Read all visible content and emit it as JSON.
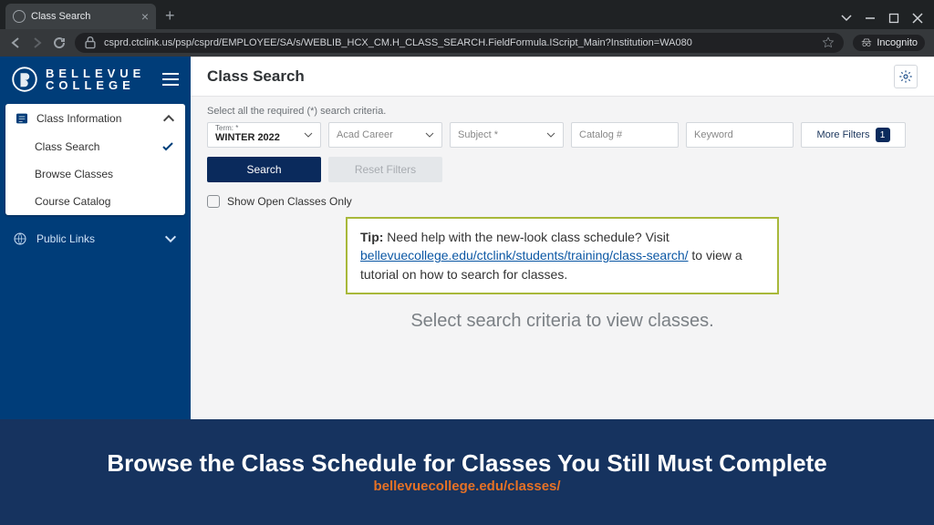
{
  "browser": {
    "tab_title": "Class Search",
    "url": "csprd.ctclink.us/psp/csprd/EMPLOYEE/SA/s/WEBLIB_HCX_CM.H_CLASS_SEARCH.FieldFormula.IScript_Main?Institution=WA080",
    "incognito_label": "Incognito"
  },
  "brand": {
    "line1": "BELLEVUE",
    "line2": "COLLEGE"
  },
  "sidebar": {
    "section_label": "Class Information",
    "items": [
      "Class Search",
      "Browse Classes",
      "Course Catalog"
    ],
    "public_label": "Public Links"
  },
  "page": {
    "title": "Class Search"
  },
  "criteria": {
    "helper": "Select all the required (*) search criteria.",
    "term_label": "Term: *",
    "term_value": "WINTER 2022",
    "acad_placeholder": "Acad Career",
    "subject_placeholder": "Subject *",
    "catalog_placeholder": "Catalog #",
    "keyword_placeholder": "Keyword",
    "more_label": "More Filters",
    "more_count": "1",
    "search_btn": "Search",
    "reset_btn": "Reset Filters",
    "open_only": "Show Open Classes Only"
  },
  "tip": {
    "prefix": "Tip:",
    "before": " Need help with the new-look class schedule? Visit ",
    "link": "bellevuecollege.edu/ctclink/students/training/class-search/",
    "after": " to view a tutorial on how to search for classes."
  },
  "hint": "Select search criteria to view classes.",
  "banner": {
    "headline": "Browse the Class Schedule for Classes You Still Must Complete",
    "url": "bellevuecollege.edu/classes/"
  }
}
